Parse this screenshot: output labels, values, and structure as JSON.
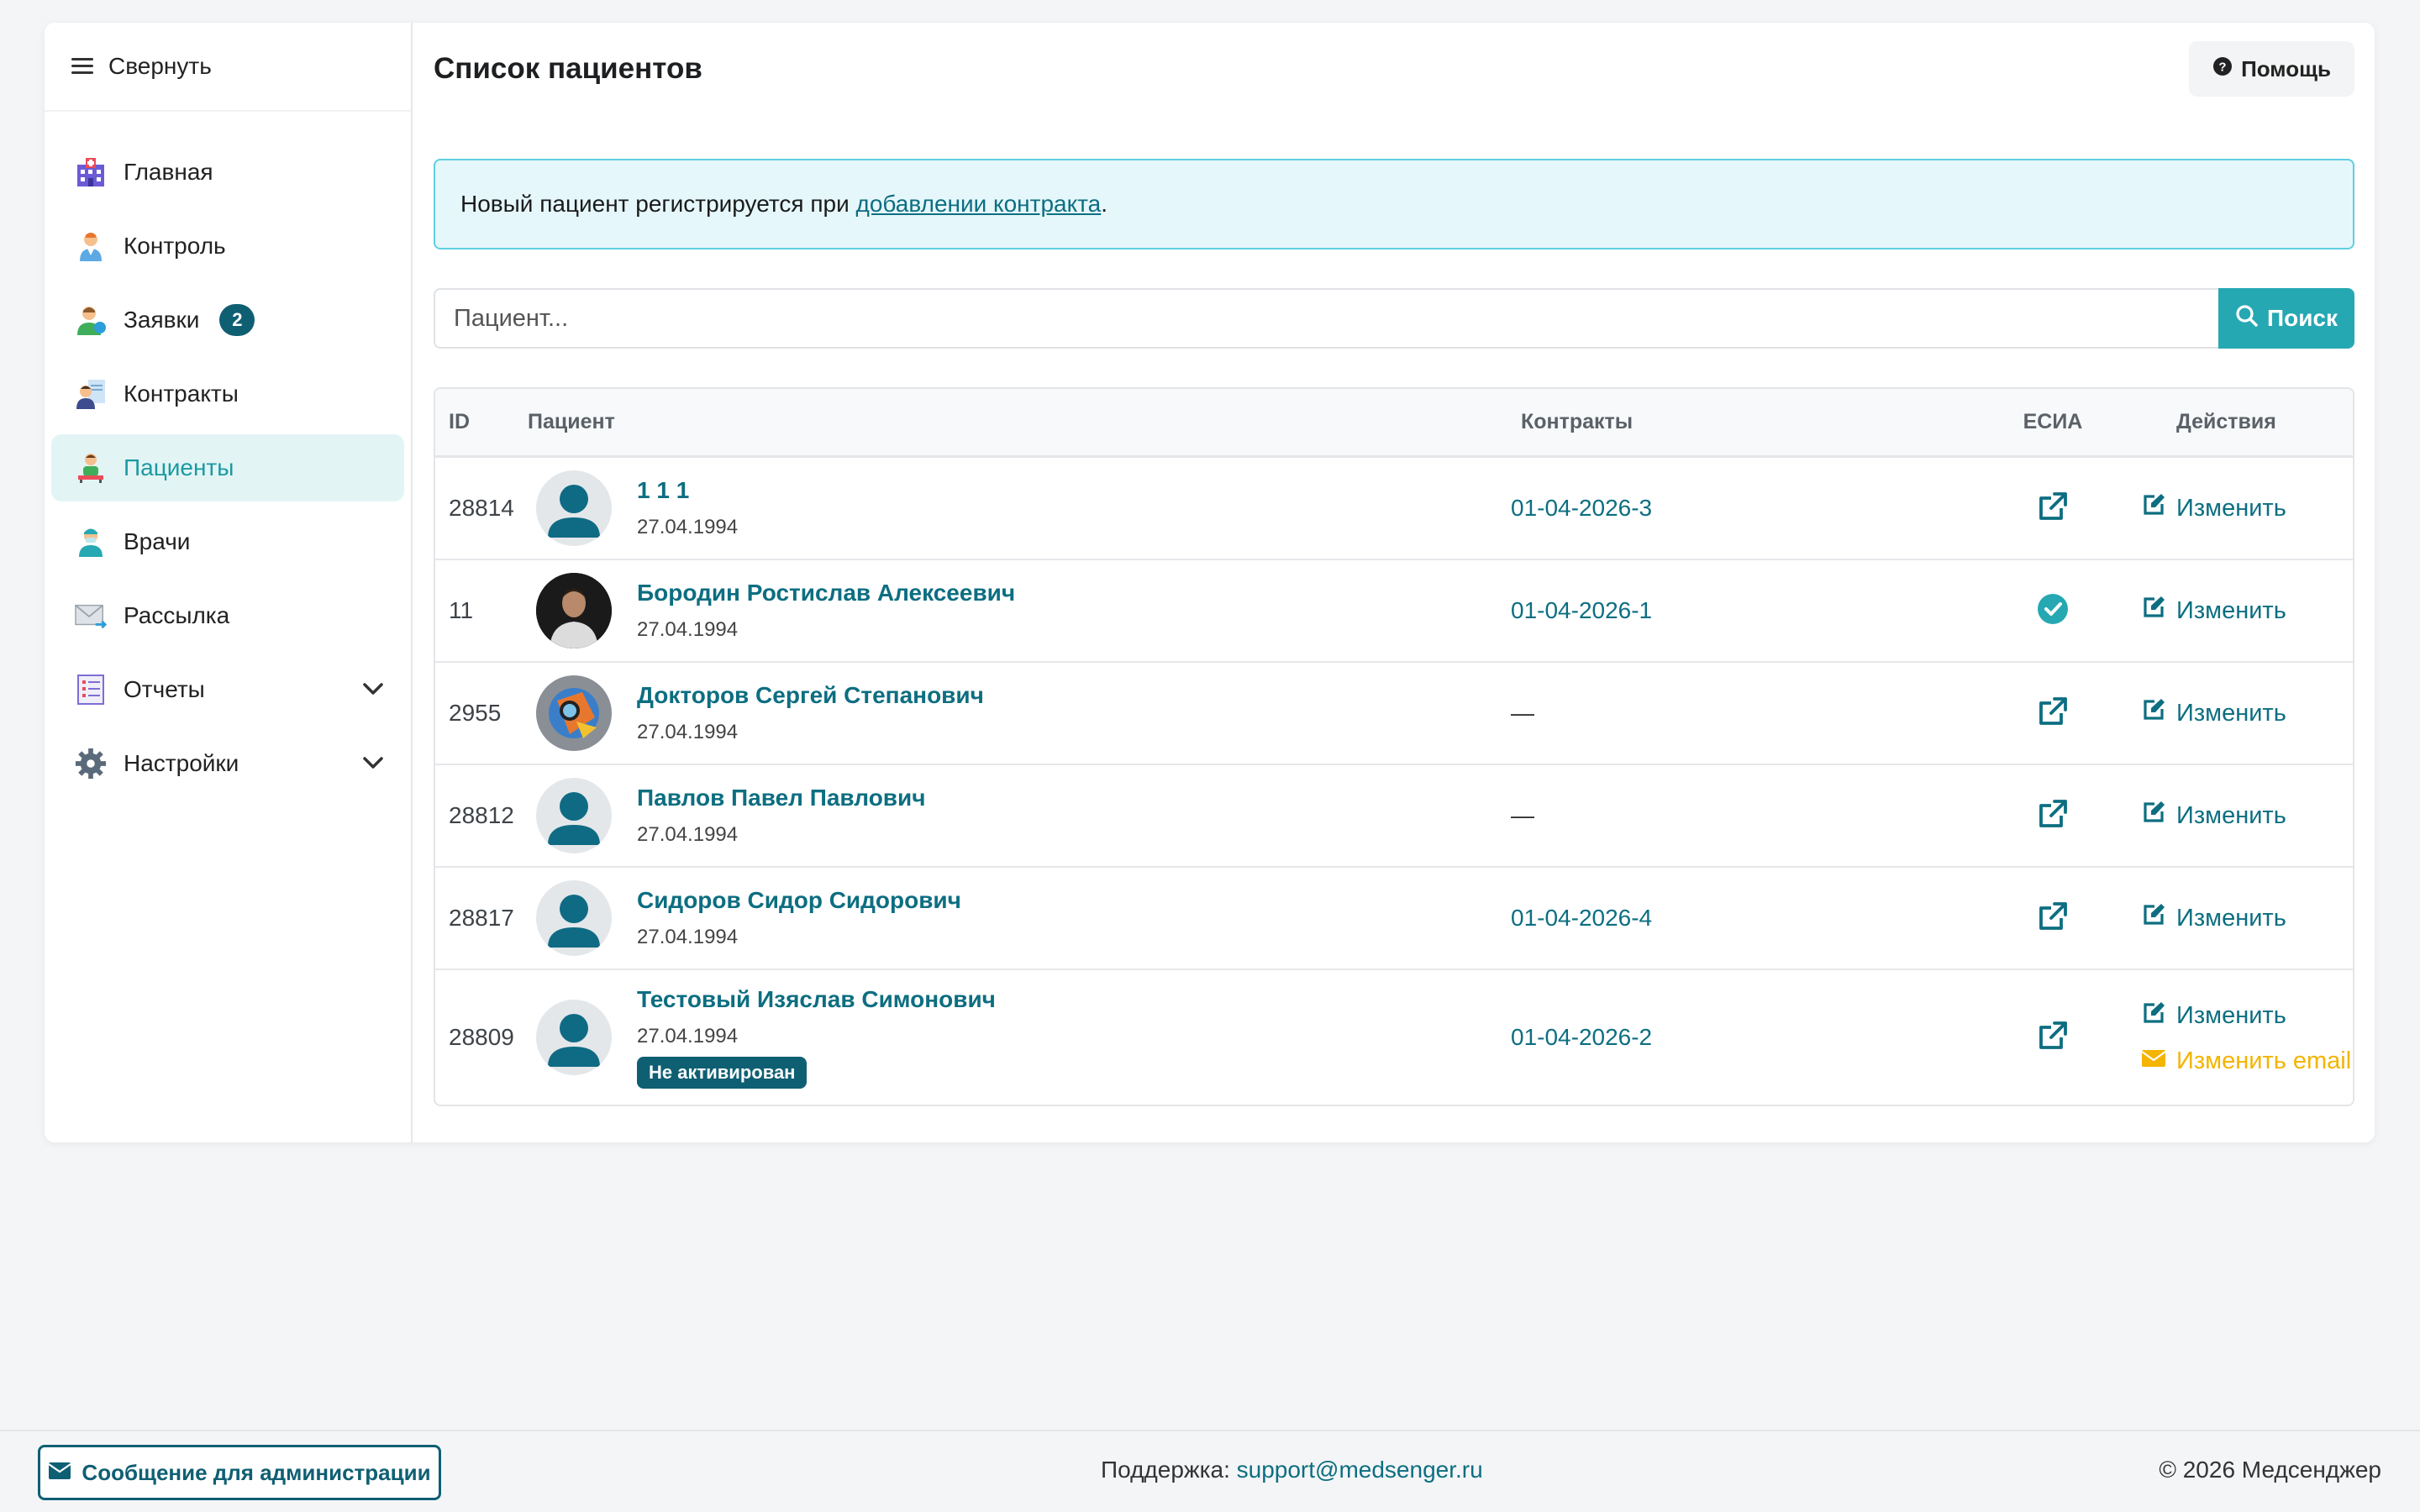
{
  "sidebar": {
    "collapse_label": "Свернуть",
    "items": [
      {
        "label": "Главная",
        "icon": "hospital-icon"
      },
      {
        "label": "Контроль",
        "icon": "doctor-icon"
      },
      {
        "label": "Заявки",
        "icon": "request-icon",
        "badge": "2"
      },
      {
        "label": "Контракты",
        "icon": "contract-icon"
      },
      {
        "label": "Пациенты",
        "icon": "patient-icon",
        "active": true
      },
      {
        "label": "Врачи",
        "icon": "physician-icon"
      },
      {
        "label": "Рассылка",
        "icon": "mail-icon"
      },
      {
        "label": "Отчеты",
        "icon": "report-icon",
        "expandable": true
      },
      {
        "label": "Настройки",
        "icon": "gear-icon",
        "expandable": true
      }
    ]
  },
  "header": {
    "title": "Список пациентов",
    "help_label": "Помощь"
  },
  "info": {
    "text_before": "Новый пациент регистрируется при ",
    "link_text": "добавлении контракта",
    "text_after": "."
  },
  "search": {
    "placeholder": "Пациент...",
    "button_label": "Поиск"
  },
  "table": {
    "headers": {
      "id": "ID",
      "patient": "Пациент",
      "contracts": "Контракты",
      "esia": "ЕСИА",
      "actions": "Действия"
    },
    "rows": [
      {
        "id": "28814",
        "name": "1 1 1",
        "date": "27.04.1994",
        "contract": "01-04-2026-3",
        "esia": "link",
        "avatar": "default"
      },
      {
        "id": "11",
        "name": "Бородин Ростислав Алексеевич",
        "date": "27.04.1994",
        "contract": "01-04-2026-1",
        "esia": "check",
        "avatar": "photo"
      },
      {
        "id": "2955",
        "name": "Докторов Сергей Степанович",
        "date": "27.04.1994",
        "contract": "—",
        "esia": "link",
        "avatar": "art"
      },
      {
        "id": "28812",
        "name": "Павлов Павел Павлович",
        "date": "27.04.1994",
        "contract": "—",
        "esia": "link",
        "avatar": "default"
      },
      {
        "id": "28817",
        "name": "Сидоров Сидор Сидорович",
        "date": "27.04.1994",
        "contract": "01-04-2026-4",
        "esia": "link",
        "avatar": "default"
      },
      {
        "id": "28809",
        "name": "Тестовый Изяслав Симонович",
        "date": "27.04.1994",
        "contract": "01-04-2026-2",
        "esia": "link",
        "avatar": "default",
        "badge": "Не активирован",
        "extra_action": "Изменить email"
      }
    ],
    "edit_label": "Изменить"
  },
  "footer": {
    "admin_button": "Сообщение для администрации",
    "support_label": "Поддержка:",
    "support_email": "support@medsenger.ru",
    "copyright": "© 2026 Медсенджер"
  },
  "colors": {
    "accent": "#26a8b3",
    "link": "#0d6e81",
    "badge": "#0f5f73",
    "warning": "#f4b400",
    "active_bg": "#e3f4f5"
  }
}
